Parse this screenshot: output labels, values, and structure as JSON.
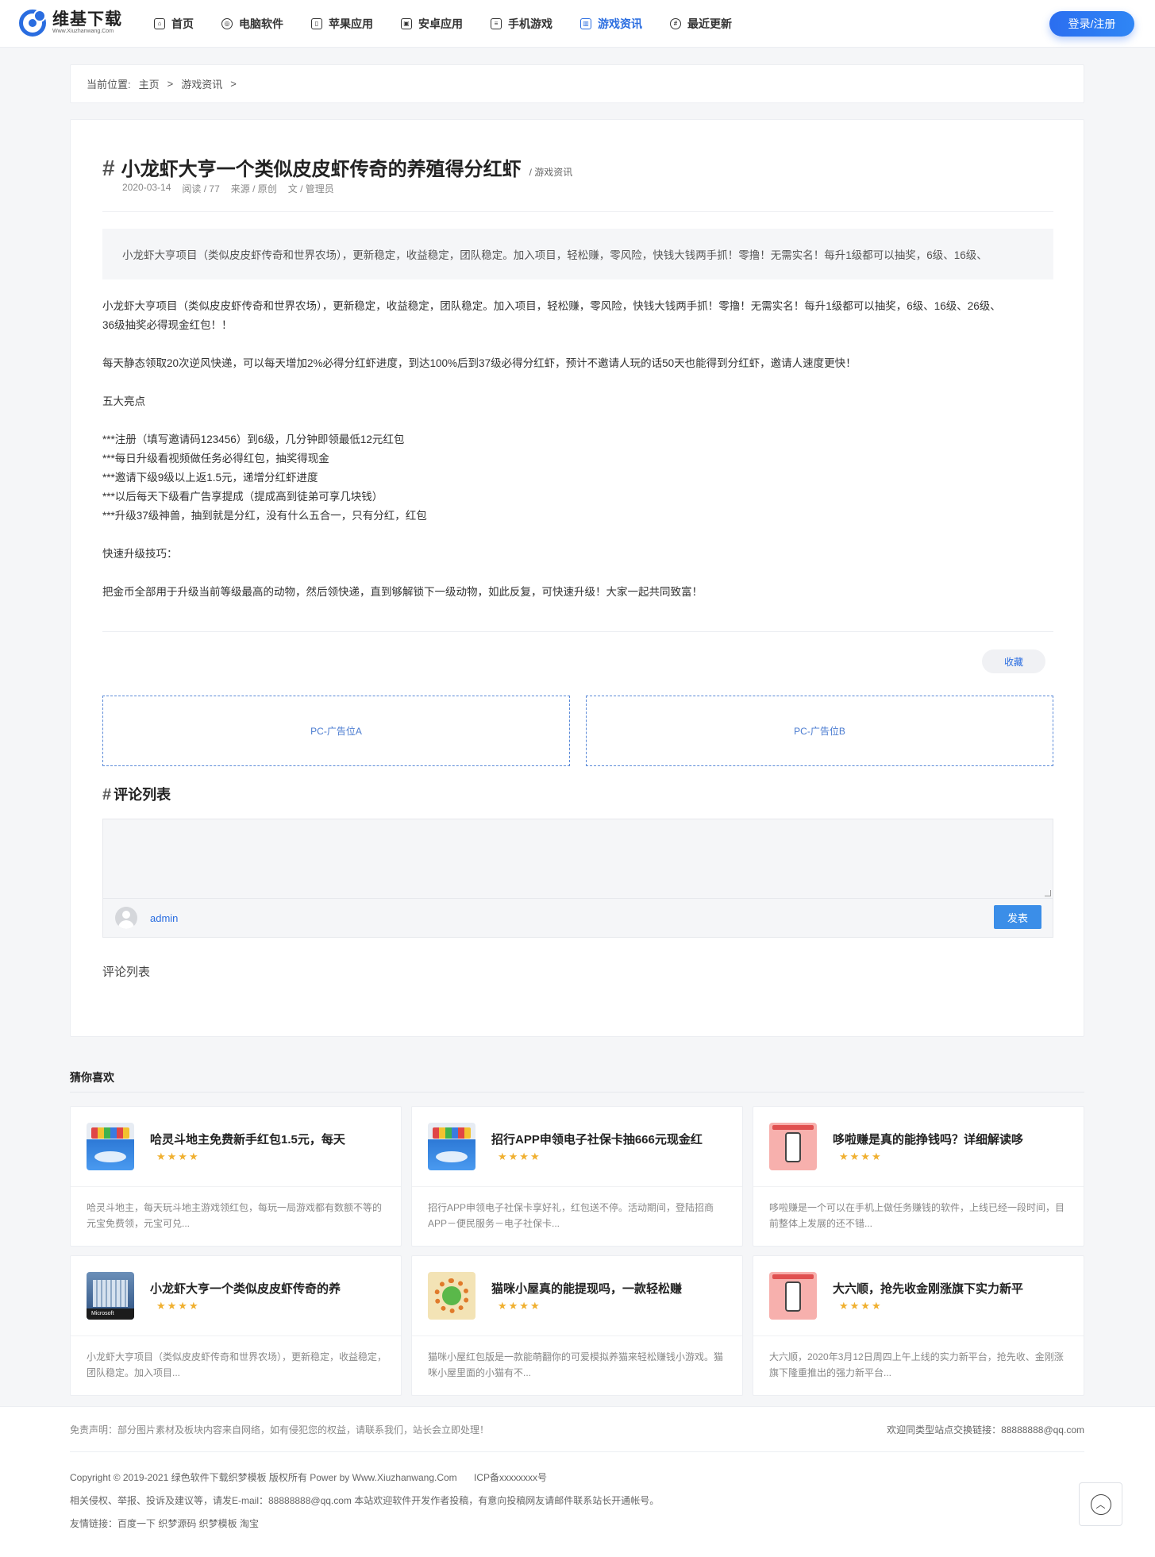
{
  "header": {
    "logo_title": "维基下载",
    "logo_sub": "Www.Xiuzhanwang.Com",
    "nav": [
      {
        "label": "首页",
        "icon": "home-icon",
        "glyph": "⌂"
      },
      {
        "label": "电脑软件",
        "icon": "compass-icon",
        "glyph": "◎"
      },
      {
        "label": "苹果应用",
        "icon": "phone-icon",
        "glyph": "▯"
      },
      {
        "label": "安卓应用",
        "icon": "tablet-icon",
        "glyph": "▣"
      },
      {
        "label": "手机游戏",
        "icon": "list-icon",
        "glyph": "≡"
      },
      {
        "label": "游戏资讯",
        "icon": "chart-icon",
        "glyph": "▥"
      },
      {
        "label": "最近更新",
        "icon": "hash-icon",
        "glyph": "#"
      }
    ],
    "active_nav": 5,
    "login_label": "登录/注册"
  },
  "breadcrumb": {
    "prefix": "当前位置:",
    "items": [
      "主页",
      ">",
      "游戏资讯",
      ">"
    ]
  },
  "article": {
    "hash": "#",
    "title": "小龙虾大亨一个类似皮皮虾传奇的养殖得分红虾",
    "category": "/ 游戏资讯",
    "date": "2020-03-14",
    "reads": "阅读 / 77",
    "source": "来源 / 原创",
    "author": "文 / 管理员",
    "summary": "小龙虾大亨项目（类似皮皮虾传奇和世界农场），更新稳定，收益稳定，团队稳定。加入项目，轻松赚，零风险，快钱大钱两手抓！零撸！无需实名！每升1级都可以抽奖，6级、16级、",
    "paragraphs": [
      "小龙虾大亨项目（类似皮皮虾传奇和世界农场），更新稳定，收益稳定，团队稳定。加入项目，轻松赚，零风险，快钱大钱两手抓！零撸！无需实名！每升1级都可以抽奖，6级、16级、26级、",
      "36级抽奖必得现金红包！！",
      "",
      "每天静态领取20次逆风快递，可以每天增加2%必得分红虾进度，到达100%后到37级必得分红虾，预计不邀请人玩的话50天也能得到分红虾，邀请人速度更快！",
      "",
      "五大亮点",
      "",
      "***注册（填写邀请码123456）到6级，几分钟即领最低12元红包",
      "***每日升级看视频做任务必得红包，抽奖得现金",
      "***邀请下级9级以上返1.5元，递增分红虾进度",
      "***以后每天下级看广告享提成（提成高到徒弟可享几块钱）",
      "***升级37级神兽，抽到就是分红，没有什么五合一，只有分红，红包",
      "",
      "快速升级技巧：",
      "",
      "把金币全部用于升级当前等级最高的动物，然后领快递，直到够解锁下一级动物，如此反复，可快速升级！大家一起共同致富！"
    ],
    "fav_label": "收藏",
    "ad_a": "PC-广告位A",
    "ad_b": "PC-广告位B"
  },
  "comments": {
    "hash": "#",
    "title": "评论列表",
    "user": "admin",
    "submit_label": "发表",
    "list_label": "评论列表"
  },
  "recommend": {
    "title": "猜你喜欢",
    "stars": "★★★★",
    "items": [
      {
        "name": "哈灵斗地主免费新手红包1.5元，每天",
        "desc": "哈灵斗地主，每天玩斗地主游戏领红包，每玩一局游戏都有数额不等的元宝免费领，元宝可兑...",
        "thumb": "blue"
      },
      {
        "name": "招行APP申领电子社保卡抽666元现金红",
        "desc": "招行APP申领电子社保卡享好礼，红包送不停。活动期间，登陆招商APP－便民服务－电子社保卡...",
        "thumb": "blue"
      },
      {
        "name": "哆啦赚是真的能挣钱吗？详细解读哆",
        "desc": "哆啦赚是一个可以在手机上做任务赚钱的软件，上线已经一段时间，目前整体上发展的还不错...",
        "thumb": "pink"
      },
      {
        "name": "小龙虾大亨一个类似皮皮虾传奇的养",
        "desc": "小龙虾大亨项目（类似皮皮虾传奇和世界农场），更新稳定，收益稳定，团队稳定。加入项目...",
        "thumb": "ms"
      },
      {
        "name": "猫咪小屋真的能提现吗，一款轻松赚",
        "desc": "猫咪小屋红包版是一款能萌翻你的可爱模拟养猫来轻松赚钱小游戏。猫咪小屋里面的小猫有不...",
        "thumb": "cat"
      },
      {
        "name": "大六顺，抢先收金刚涨旗下实力新平",
        "desc": "大六顺，2020年3月12日周四上午上线的实力新平台，抢先收、金刚涨旗下隆重推出的强力新平台...",
        "thumb": "pink"
      }
    ],
    "ms_label": "Microsoft"
  },
  "footer": {
    "disclaimer": "免责声明：部分图片素材及板块内容来自网络，如有侵犯您的权益，请联系我们，站长会立即处理！",
    "contact": "欢迎同类型站点交换链接：88888888@qq.com",
    "copyright": "Copyright © 2019-2021 绿色软件下载织梦模板 版权所有 Power by Www.Xiuzhanwang.Com",
    "icp": "ICP备xxxxxxxx号",
    "report": "相关侵权、举报、投诉及建议等，请发E-mail：88888888@qq.com 本站欢迎软件开发作者投稿，有意向投稿网友请邮件联系站长开通帐号。",
    "links": "友情链接：百度一下 织梦源码 织梦模板 淘宝",
    "top_glyph": "︿"
  }
}
